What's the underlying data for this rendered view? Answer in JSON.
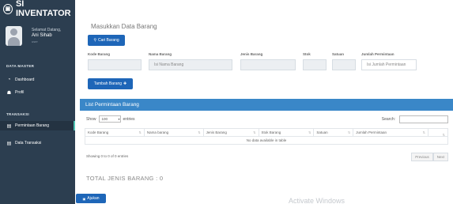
{
  "app": {
    "title": "SI INVENTATOR",
    "logo_glyph": "▣"
  },
  "profile": {
    "welcome": "Selamat Datang,",
    "name": "Ani Sihab",
    "role": "user"
  },
  "sidebar": {
    "data_master_label": "DATA MASTER",
    "transaksi_label": "TRANSAKSI",
    "items": [
      {
        "label": "Dashboard",
        "icon": "dashboard-icon",
        "glyph": "◔"
      },
      {
        "label": "Profil",
        "icon": "users-icon",
        "glyph": "☗"
      },
      {
        "label": "Permintaan Barang",
        "icon": "list-icon",
        "glyph": "▤"
      },
      {
        "label": "Data Transaksi",
        "icon": "table-icon",
        "glyph": "▤"
      }
    ]
  },
  "form": {
    "title": "Masukkan Data Barang",
    "search_button": "Cari Barang",
    "search_glyph": "⚲",
    "labels": {
      "kode": "Kode Barang",
      "nama": "Nama Barang",
      "jenis": "Jenis Barang",
      "stok": "Stok",
      "satuan": "Satuan",
      "jumlah": "Jumlah Permintaan"
    },
    "placeholders": {
      "nama": "Isi Nama Barang",
      "jumlah": "Isi Jumlah Permintaan"
    },
    "add_button": "Tambah Barang",
    "add_glyph": "✚"
  },
  "list": {
    "header": "List Permintaan Barang",
    "show_label": "Show",
    "show_value": "100",
    "entries_label": "entries",
    "search_label": "Search:",
    "columns": [
      "Kode Barang",
      "Nama barang",
      "Jenis Barang",
      "Stok Barang",
      "Satuan",
      "Jumlah Permintaan",
      ""
    ],
    "empty_text": "No data available in table",
    "info": "Showing 0 to 0 of 0 entries",
    "prev": "Previous",
    "next": "Next",
    "total": "TOTAL JENIS BARANG : 0"
  },
  "footer": {
    "button": "Ajukan",
    "button_glyph": "▣"
  },
  "watermark": "Activate Windows",
  "colors": {
    "sidebar": "#2c3e50",
    "primary": "#1e66b8",
    "panel_header": "#3a87c8",
    "active_border": "#4fc3b3"
  }
}
